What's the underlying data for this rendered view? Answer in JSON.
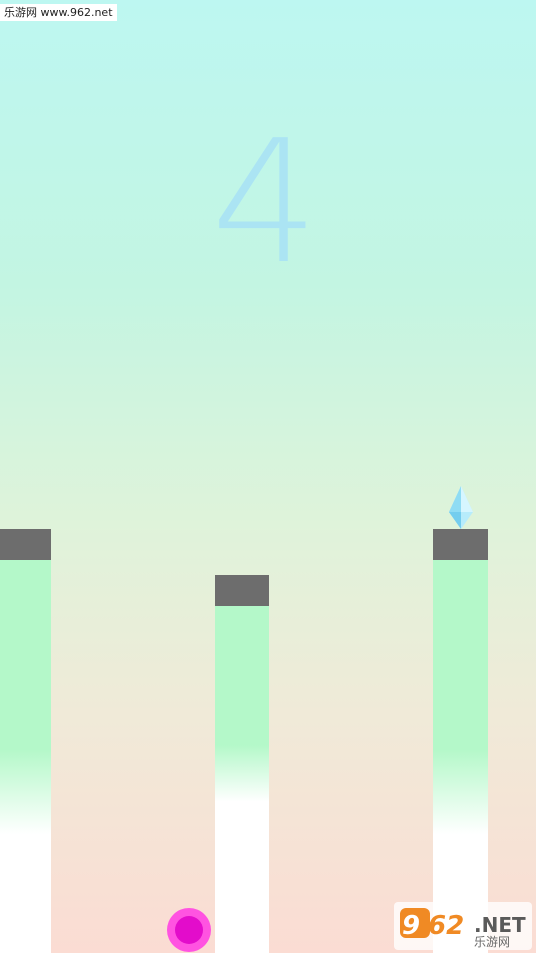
{
  "watermark": {
    "top_text": "乐游网 www.962.net",
    "logo_text": "962.NET",
    "logo_subtext": "乐游网"
  },
  "game": {
    "score": "4",
    "progress_level": 4
  },
  "colors": {
    "pillar_cap": "#6d6d6d",
    "pillar_top": "#b4f8c9",
    "ball_outer": "#ff53e1",
    "ball_inner": "#e30ccb",
    "gem": "#8fdcf4",
    "score": "#a9e3f5"
  },
  "icons": {
    "gem": "diamond-gem-icon",
    "ball": "player-ball-icon"
  }
}
